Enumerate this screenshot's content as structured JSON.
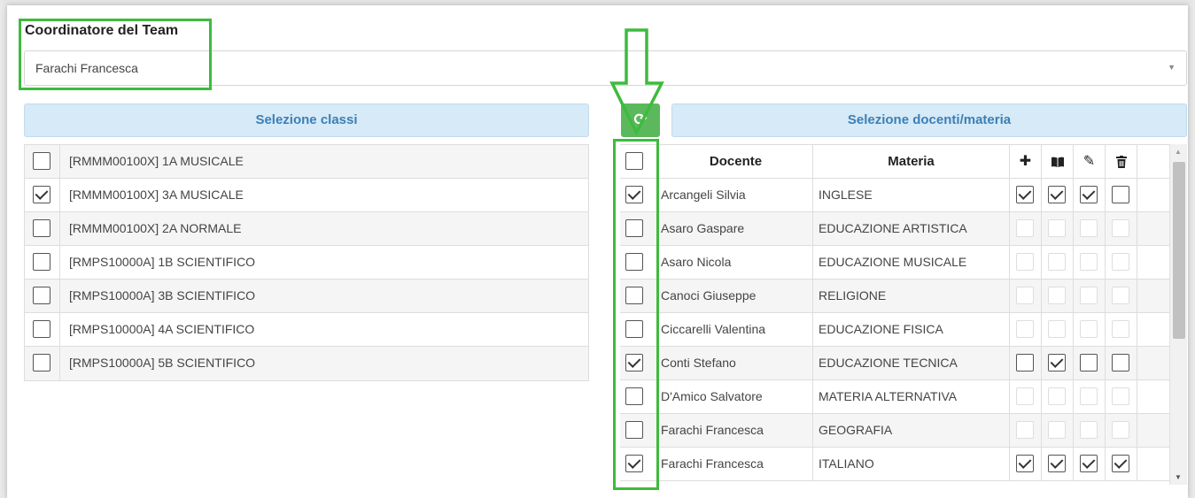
{
  "coordinator": {
    "label": "Coordinatore del Team",
    "value": "Farachi Francesca"
  },
  "classes_header": "Selezione classi",
  "teachers_header": "Selezione docenti/materia",
  "refresh_icon": "refresh-icon",
  "classes": [
    {
      "label": "[RMMM00100X] 1A MUSICALE",
      "checked": false
    },
    {
      "label": "[RMMM00100X] 3A MUSICALE",
      "checked": true
    },
    {
      "label": "[RMMM00100X] 2A NORMALE",
      "checked": false
    },
    {
      "label": "[RMPS10000A] 1B SCIENTIFICO",
      "checked": false
    },
    {
      "label": "[RMPS10000A] 3B SCIENTIFICO",
      "checked": false
    },
    {
      "label": "[RMPS10000A] 4A SCIENTIFICO",
      "checked": false
    },
    {
      "label": "[RMPS10000A] 5B SCIENTIFICO",
      "checked": false
    }
  ],
  "teachers_table": {
    "headers": {
      "docente": "Docente",
      "materia": "Materia",
      "icons": [
        "plus-icon",
        "book-icon",
        "pencil-icon",
        "trash-icon"
      ]
    },
    "rows": [
      {
        "docente": "Arcangeli Silvia",
        "materia": "INGLESE",
        "selected": true,
        "perms": [
          true,
          true,
          true,
          false
        ],
        "enabled": true
      },
      {
        "docente": "Asaro Gaspare",
        "materia": "EDUCAZIONE ARTISTICA",
        "selected": false,
        "perms": [
          false,
          false,
          false,
          false
        ],
        "enabled": false
      },
      {
        "docente": "Asaro Nicola",
        "materia": "EDUCAZIONE MUSICALE",
        "selected": false,
        "perms": [
          false,
          false,
          false,
          false
        ],
        "enabled": false
      },
      {
        "docente": "Canoci Giuseppe",
        "materia": "RELIGIONE",
        "selected": false,
        "perms": [
          false,
          false,
          false,
          false
        ],
        "enabled": false
      },
      {
        "docente": "Ciccarelli Valentina",
        "materia": "EDUCAZIONE FISICA",
        "selected": false,
        "perms": [
          false,
          false,
          false,
          false
        ],
        "enabled": false
      },
      {
        "docente": "Conti Stefano",
        "materia": "EDUCAZIONE TECNICA",
        "selected": true,
        "perms": [
          false,
          true,
          false,
          false
        ],
        "enabled": true
      },
      {
        "docente": "D'Amico Salvatore",
        "materia": "MATERIA ALTERNATIVA",
        "selected": false,
        "perms": [
          false,
          false,
          false,
          false
        ],
        "enabled": false
      },
      {
        "docente": "Farachi Francesca",
        "materia": "GEOGRAFIA",
        "selected": false,
        "perms": [
          false,
          false,
          false,
          false
        ],
        "enabled": false
      },
      {
        "docente": "Farachi Francesca",
        "materia": "ITALIANO",
        "selected": true,
        "perms": [
          true,
          true,
          true,
          true
        ],
        "enabled": true
      }
    ]
  },
  "colors": {
    "annotation_green": "#3dbb3d",
    "header_blue_bg": "#d6eaf7",
    "header_blue_text": "#3d7fb5",
    "refresh_green": "#5cb85c"
  }
}
